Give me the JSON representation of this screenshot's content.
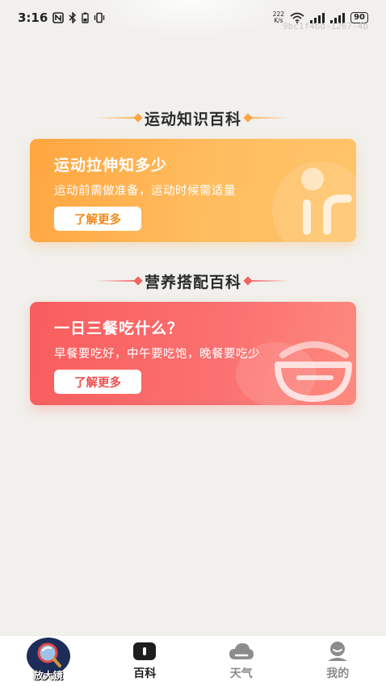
{
  "status_bar": {
    "time": "3:16",
    "net_speed_value": "222",
    "net_speed_unit": "K/s",
    "battery": "90"
  },
  "watermark": "9bc1f4bd-1267-4b",
  "sections": [
    {
      "header": "运动知识百科",
      "card": {
        "title": "运动拉伸知多少",
        "subtitle": "运动前需做准备，运动时候需适量",
        "button": "了解更多"
      }
    },
    {
      "header": "营养搭配百科",
      "card": {
        "title": "一日三餐吃什么？",
        "subtitle": "早餐要吃好，中午要吃饱，晚餐要吃少",
        "button": "了解更多"
      }
    }
  ],
  "tabbar": {
    "tabs": [
      {
        "label": "放大镜",
        "icon": "magnifier-icon",
        "active": false
      },
      {
        "label": "百科",
        "icon": "encyclopedia-icon",
        "active": true
      },
      {
        "label": "天气",
        "icon": "cloud-icon",
        "active": false
      },
      {
        "label": "我的",
        "icon": "user-icon",
        "active": false
      }
    ]
  },
  "colors": {
    "background": "#f1f0ec",
    "orange_accent": "#ffa640",
    "red_accent": "#f95d5d",
    "active_tab": "#1d1d1d",
    "inactive_tab": "#8c8c8c"
  }
}
